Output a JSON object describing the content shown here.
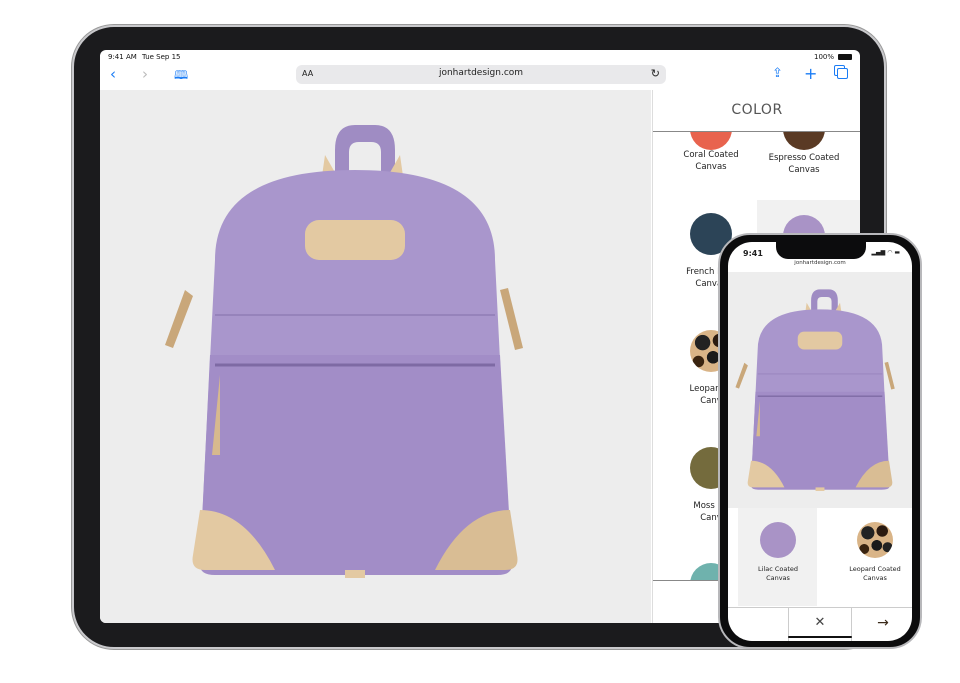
{
  "ipad": {
    "status": {
      "time": "9:41 AM",
      "date": "Tue Sep 15",
      "battery": "100%"
    },
    "toolbar": {
      "back_icon": "chevron-left-icon",
      "forward_icon": "chevron-right-icon",
      "bookmarks_icon": "book-icon",
      "text_size": "AA",
      "url": "jonhartdesign.com",
      "reload_icon": "reload-icon",
      "share_icon": "share-icon",
      "add_icon": "plus-icon",
      "tabs_icon": "tabs-icon"
    },
    "panel": {
      "heading": "COLOR",
      "swatches": [
        {
          "line1": "Coral Coated",
          "line2": "Canvas",
          "color": "#e8634e"
        },
        {
          "line1": "Espresso Coated",
          "line2": "Canvas",
          "color": "#5a3a24"
        },
        {
          "line1": "French Blue",
          "line2": "Canvas",
          "color": "#2c4457"
        },
        {
          "line1": "Lilac",
          "line2": "",
          "color": "#a993c6"
        },
        {
          "line1": "Leopard C",
          "line2": "Canv",
          "color": "#d9b487"
        },
        {
          "line1": "Moss Co",
          "line2": "Canv",
          "color": "#746b3d"
        },
        {
          "line1": "",
          "line2": "",
          "color": "#6fb2ad"
        }
      ]
    }
  },
  "iphone": {
    "status": {
      "time": "9:41"
    },
    "url": "jonhartdesign.com",
    "swatches": [
      {
        "line1": "Lilac Coated",
        "line2": "Canvas",
        "color": "#a993c6"
      },
      {
        "line1": "Leopard Coated",
        "line2": "Canvas",
        "color": "#d9b487"
      }
    ],
    "close_symbol": "✕",
    "next_symbol": "→"
  },
  "colors": {
    "bag": "#a996cc",
    "leather": "#e3c9a2",
    "link_blue": "#1a7cf5"
  }
}
